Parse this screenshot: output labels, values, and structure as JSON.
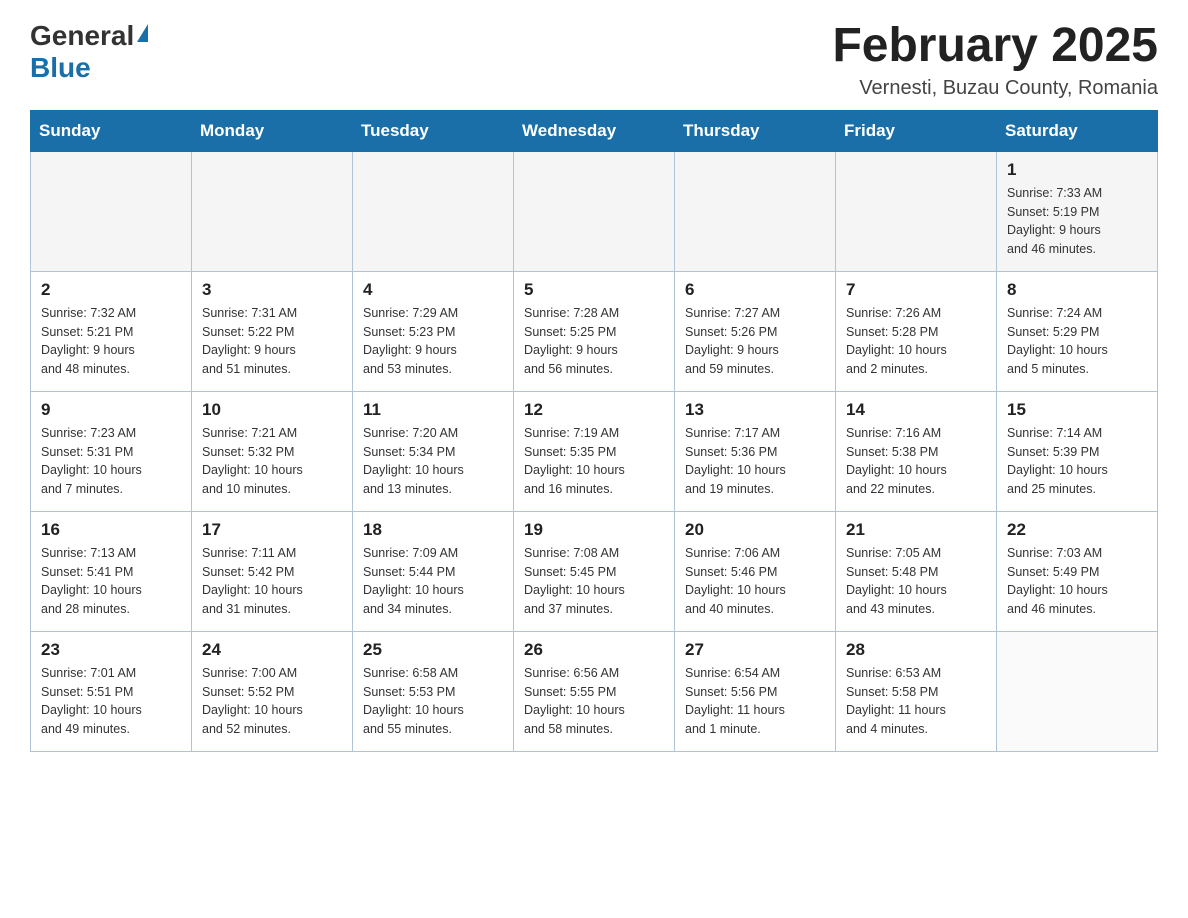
{
  "header": {
    "logo_general": "General",
    "logo_blue": "Blue",
    "month_title": "February 2025",
    "location": "Vernesti, Buzau County, Romania"
  },
  "days_of_week": [
    "Sunday",
    "Monday",
    "Tuesday",
    "Wednesday",
    "Thursday",
    "Friday",
    "Saturday"
  ],
  "weeks": [
    [
      {
        "day": "",
        "info": ""
      },
      {
        "day": "",
        "info": ""
      },
      {
        "day": "",
        "info": ""
      },
      {
        "day": "",
        "info": ""
      },
      {
        "day": "",
        "info": ""
      },
      {
        "day": "",
        "info": ""
      },
      {
        "day": "1",
        "info": "Sunrise: 7:33 AM\nSunset: 5:19 PM\nDaylight: 9 hours\nand 46 minutes."
      }
    ],
    [
      {
        "day": "2",
        "info": "Sunrise: 7:32 AM\nSunset: 5:21 PM\nDaylight: 9 hours\nand 48 minutes."
      },
      {
        "day": "3",
        "info": "Sunrise: 7:31 AM\nSunset: 5:22 PM\nDaylight: 9 hours\nand 51 minutes."
      },
      {
        "day": "4",
        "info": "Sunrise: 7:29 AM\nSunset: 5:23 PM\nDaylight: 9 hours\nand 53 minutes."
      },
      {
        "day": "5",
        "info": "Sunrise: 7:28 AM\nSunset: 5:25 PM\nDaylight: 9 hours\nand 56 minutes."
      },
      {
        "day": "6",
        "info": "Sunrise: 7:27 AM\nSunset: 5:26 PM\nDaylight: 9 hours\nand 59 minutes."
      },
      {
        "day": "7",
        "info": "Sunrise: 7:26 AM\nSunset: 5:28 PM\nDaylight: 10 hours\nand 2 minutes."
      },
      {
        "day": "8",
        "info": "Sunrise: 7:24 AM\nSunset: 5:29 PM\nDaylight: 10 hours\nand 5 minutes."
      }
    ],
    [
      {
        "day": "9",
        "info": "Sunrise: 7:23 AM\nSunset: 5:31 PM\nDaylight: 10 hours\nand 7 minutes."
      },
      {
        "day": "10",
        "info": "Sunrise: 7:21 AM\nSunset: 5:32 PM\nDaylight: 10 hours\nand 10 minutes."
      },
      {
        "day": "11",
        "info": "Sunrise: 7:20 AM\nSunset: 5:34 PM\nDaylight: 10 hours\nand 13 minutes."
      },
      {
        "day": "12",
        "info": "Sunrise: 7:19 AM\nSunset: 5:35 PM\nDaylight: 10 hours\nand 16 minutes."
      },
      {
        "day": "13",
        "info": "Sunrise: 7:17 AM\nSunset: 5:36 PM\nDaylight: 10 hours\nand 19 minutes."
      },
      {
        "day": "14",
        "info": "Sunrise: 7:16 AM\nSunset: 5:38 PM\nDaylight: 10 hours\nand 22 minutes."
      },
      {
        "day": "15",
        "info": "Sunrise: 7:14 AM\nSunset: 5:39 PM\nDaylight: 10 hours\nand 25 minutes."
      }
    ],
    [
      {
        "day": "16",
        "info": "Sunrise: 7:13 AM\nSunset: 5:41 PM\nDaylight: 10 hours\nand 28 minutes."
      },
      {
        "day": "17",
        "info": "Sunrise: 7:11 AM\nSunset: 5:42 PM\nDaylight: 10 hours\nand 31 minutes."
      },
      {
        "day": "18",
        "info": "Sunrise: 7:09 AM\nSunset: 5:44 PM\nDaylight: 10 hours\nand 34 minutes."
      },
      {
        "day": "19",
        "info": "Sunrise: 7:08 AM\nSunset: 5:45 PM\nDaylight: 10 hours\nand 37 minutes."
      },
      {
        "day": "20",
        "info": "Sunrise: 7:06 AM\nSunset: 5:46 PM\nDaylight: 10 hours\nand 40 minutes."
      },
      {
        "day": "21",
        "info": "Sunrise: 7:05 AM\nSunset: 5:48 PM\nDaylight: 10 hours\nand 43 minutes."
      },
      {
        "day": "22",
        "info": "Sunrise: 7:03 AM\nSunset: 5:49 PM\nDaylight: 10 hours\nand 46 minutes."
      }
    ],
    [
      {
        "day": "23",
        "info": "Sunrise: 7:01 AM\nSunset: 5:51 PM\nDaylight: 10 hours\nand 49 minutes."
      },
      {
        "day": "24",
        "info": "Sunrise: 7:00 AM\nSunset: 5:52 PM\nDaylight: 10 hours\nand 52 minutes."
      },
      {
        "day": "25",
        "info": "Sunrise: 6:58 AM\nSunset: 5:53 PM\nDaylight: 10 hours\nand 55 minutes."
      },
      {
        "day": "26",
        "info": "Sunrise: 6:56 AM\nSunset: 5:55 PM\nDaylight: 10 hours\nand 58 minutes."
      },
      {
        "day": "27",
        "info": "Sunrise: 6:54 AM\nSunset: 5:56 PM\nDaylight: 11 hours\nand 1 minute."
      },
      {
        "day": "28",
        "info": "Sunrise: 6:53 AM\nSunset: 5:58 PM\nDaylight: 11 hours\nand 4 minutes."
      },
      {
        "day": "",
        "info": ""
      }
    ]
  ]
}
